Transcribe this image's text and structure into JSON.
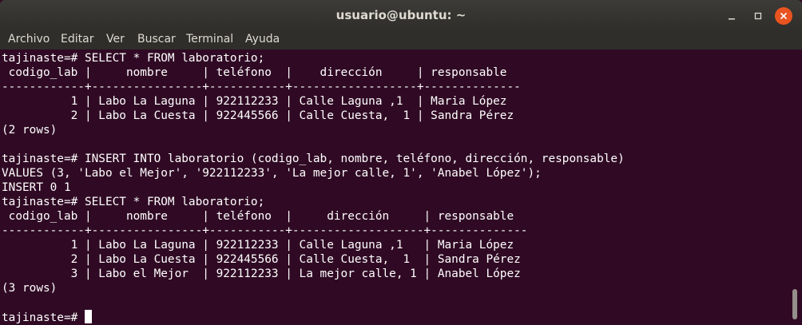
{
  "window": {
    "title": "usuario@ubuntu: ~"
  },
  "menu": [
    "Archivo",
    "Editar",
    "Ver",
    "Buscar",
    "Terminal",
    "Ayuda"
  ],
  "terminal": {
    "lines": [
      "tajinaste=# SELECT * FROM laboratorio;",
      " codigo_lab |     nombre     | teléfono  |    dirección     | responsable",
      "------------+----------------+-----------+------------------+--------------",
      "          1 | Labo La Laguna | 922112233 | Calle Laguna ,1  | Maria López",
      "          2 | Labo La Cuesta | 922445566 | Calle Cuesta,  1 | Sandra Pérez",
      "(2 rows)",
      "",
      "tajinaste=# INSERT INTO laboratorio (codigo_lab, nombre, teléfono, dirección, responsable)",
      "VALUES (3, 'Labo el Mejor', '922112233', 'La mejor calle, 1', 'Anabel López');",
      "INSERT 0 1",
      "tajinaste=# SELECT * FROM laboratorio;",
      " codigo_lab |     nombre     | teléfono  |     dirección     | responsable",
      "------------+----------------+-----------+-------------------+--------------",
      "          1 | Labo La Laguna | 922112233 | Calle Laguna ,1   | Maria López",
      "          2 | Labo La Cuesta | 922445566 | Calle Cuesta,  1  | Sandra Pérez",
      "          3 | Labo el Mejor  | 922112233 | La mejor calle, 1 | Anabel López",
      "(3 rows)",
      ""
    ],
    "prompt": "tajinaste=# "
  }
}
